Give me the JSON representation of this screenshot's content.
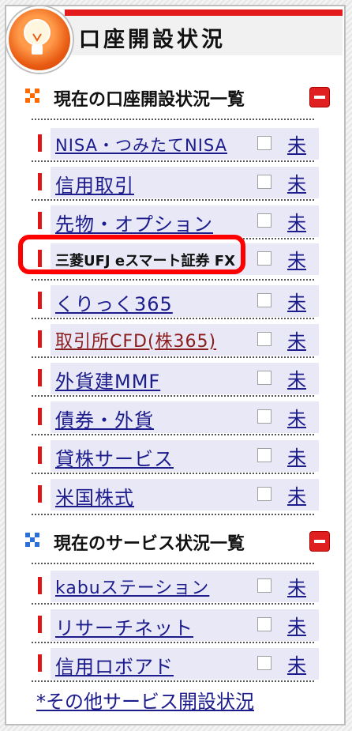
{
  "header": {
    "title": "口座開設状況"
  },
  "sections": [
    {
      "title": "現在の口座開設状況一覧",
      "items": [
        {
          "label": "NISA・つみたてNISA",
          "status": "未"
        },
        {
          "label": "信用取引",
          "status": "未"
        },
        {
          "label": "先物・オプション",
          "status": "未"
        },
        {
          "label": "三菱UFJ eスマート証券 FX",
          "status": "未"
        },
        {
          "label": "くりっく365",
          "status": "未"
        },
        {
          "label": "取引所CFD(株365)",
          "status": "未"
        },
        {
          "label": "外貨建MMF",
          "status": "未"
        },
        {
          "label": "債券・外貨",
          "status": "未"
        },
        {
          "label": "貸株サービス",
          "status": "未"
        },
        {
          "label": "米国株式",
          "status": "未"
        }
      ]
    },
    {
      "title": "現在のサービス状況一覧",
      "items": [
        {
          "label": "kabuステーション",
          "status": "未"
        },
        {
          "label": "リサーチネット",
          "status": "未"
        },
        {
          "label": "信用ロボアド",
          "status": "未"
        }
      ]
    }
  ],
  "footer": {
    "more_link": "*その他サービス開設状況"
  },
  "colors": {
    "accent": "#e31b1b",
    "link": "#1c1c8c",
    "highlight": "#ff0000"
  }
}
